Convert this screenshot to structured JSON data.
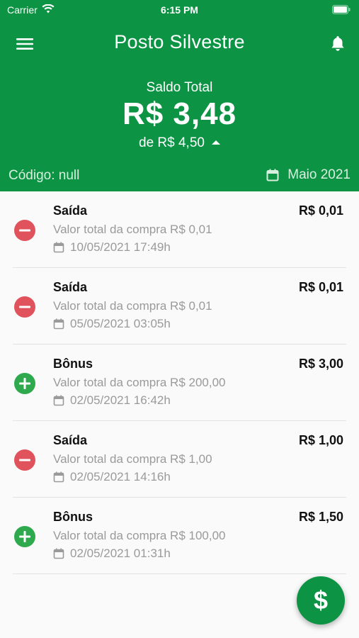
{
  "status_bar": {
    "carrier": "Carrier",
    "time": "6:15 PM"
  },
  "header": {
    "title": "Posto Silvestre",
    "balance_label": "Saldo Total",
    "balance_value": "R$ 3,48",
    "balance_sub": "de R$ 4,50",
    "code_label": "Código: null",
    "month": "Maio 2021"
  },
  "transactions": [
    {
      "type": "out",
      "title": "Saída",
      "amount": "R$ 0,01",
      "subtitle": "Valor total da compra R$ 0,01",
      "date": "10/05/2021 17:49h"
    },
    {
      "type": "out",
      "title": "Saída",
      "amount": "R$ 0,01",
      "subtitle": "Valor total da compra R$ 0,01",
      "date": "05/05/2021 03:05h"
    },
    {
      "type": "in",
      "title": "Bônus",
      "amount": "R$ 3,00",
      "subtitle": "Valor total da compra R$ 200,00",
      "date": "02/05/2021 16:42h"
    },
    {
      "type": "out",
      "title": "Saída",
      "amount": "R$ 1,00",
      "subtitle": "Valor total da compra R$ 1,00",
      "date": "02/05/2021 14:16h"
    },
    {
      "type": "in",
      "title": "Bônus",
      "amount": "R$ 1,50",
      "subtitle": "Valor total da compra R$ 100,00",
      "date": "02/05/2021 01:31h"
    }
  ],
  "fab": {
    "symbol": "$"
  },
  "colors": {
    "primary": "#0c9444",
    "negative": "#e0525c",
    "positive": "#2fa94e"
  },
  "icons": {
    "menu": "menu-icon",
    "bell": "bell-icon",
    "calendar": "calendar-icon",
    "minus": "minus-circle-icon",
    "plus": "plus-circle-icon"
  }
}
